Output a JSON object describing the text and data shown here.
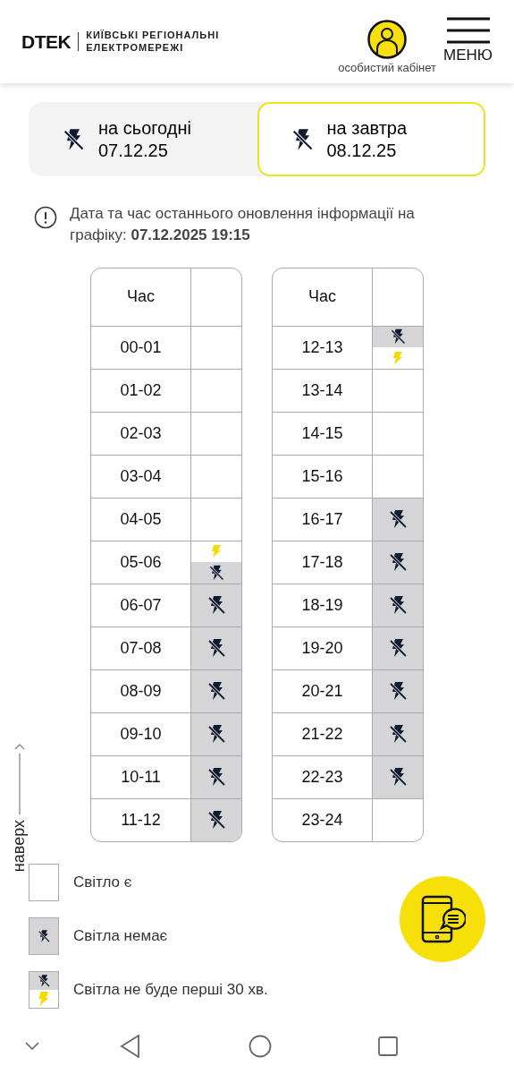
{
  "header": {
    "logo": "DTEK",
    "brand_lines": [
      "КИЇВСЬКІ РЕГІОНАЛЬНІ",
      "ЕЛЕКТРОМЕРЕЖІ"
    ],
    "account_label": "особистий кабінет",
    "menu_label": "МЕНЮ"
  },
  "tabs": [
    {
      "label": "на сьогодні",
      "date": "07.12.25",
      "selected": false
    },
    {
      "label": "на завтра",
      "date": "08.12.25",
      "selected": true
    }
  ],
  "info": "Дата та час останнього оновлення інформації на графіку: **07.12.2025 19:15**",
  "tables": [
    {
      "column_1": "Час",
      "rows": [
        {
          "hours": "00-01",
          "kind": "on"
        },
        {
          "hours": "01-02",
          "kind": "on"
        },
        {
          "hours": "02-03",
          "kind": "on"
        },
        {
          "hours": "03-04",
          "kind": "on"
        },
        {
          "hours": "04-05",
          "kind": "on"
        },
        {
          "hours": "05-06",
          "kind": "off_second_half"
        },
        {
          "hours": "06-07",
          "kind": "off"
        },
        {
          "hours": "07-08",
          "kind": "off"
        },
        {
          "hours": "08-09",
          "kind": "off"
        },
        {
          "hours": "09-10",
          "kind": "off"
        },
        {
          "hours": "10-11",
          "kind": "off"
        },
        {
          "hours": "11-12",
          "kind": "off"
        }
      ]
    },
    {
      "column_1": "Час",
      "rows": [
        {
          "hours": "12-13",
          "kind": "off_first_half"
        },
        {
          "hours": "13-14",
          "kind": "on"
        },
        {
          "hours": "14-15",
          "kind": "on"
        },
        {
          "hours": "15-16",
          "kind": "on"
        },
        {
          "hours": "16-17",
          "kind": "off"
        },
        {
          "hours": "17-18",
          "kind": "off"
        },
        {
          "hours": "18-19",
          "kind": "off"
        },
        {
          "hours": "19-20",
          "kind": "off"
        },
        {
          "hours": "20-21",
          "kind": "off"
        },
        {
          "hours": "21-22",
          "kind": "off"
        },
        {
          "hours": "22-23",
          "kind": "off"
        },
        {
          "hours": "23-24",
          "kind": "on"
        }
      ]
    }
  ],
  "legend": [
    {
      "kind": "on",
      "label": "Світло є"
    },
    {
      "kind": "off",
      "label": "Світла немає"
    },
    {
      "kind": "off_first_half",
      "label": "Світла не буде перші 30 хв."
    }
  ],
  "scroll_top_label": "наверх"
}
